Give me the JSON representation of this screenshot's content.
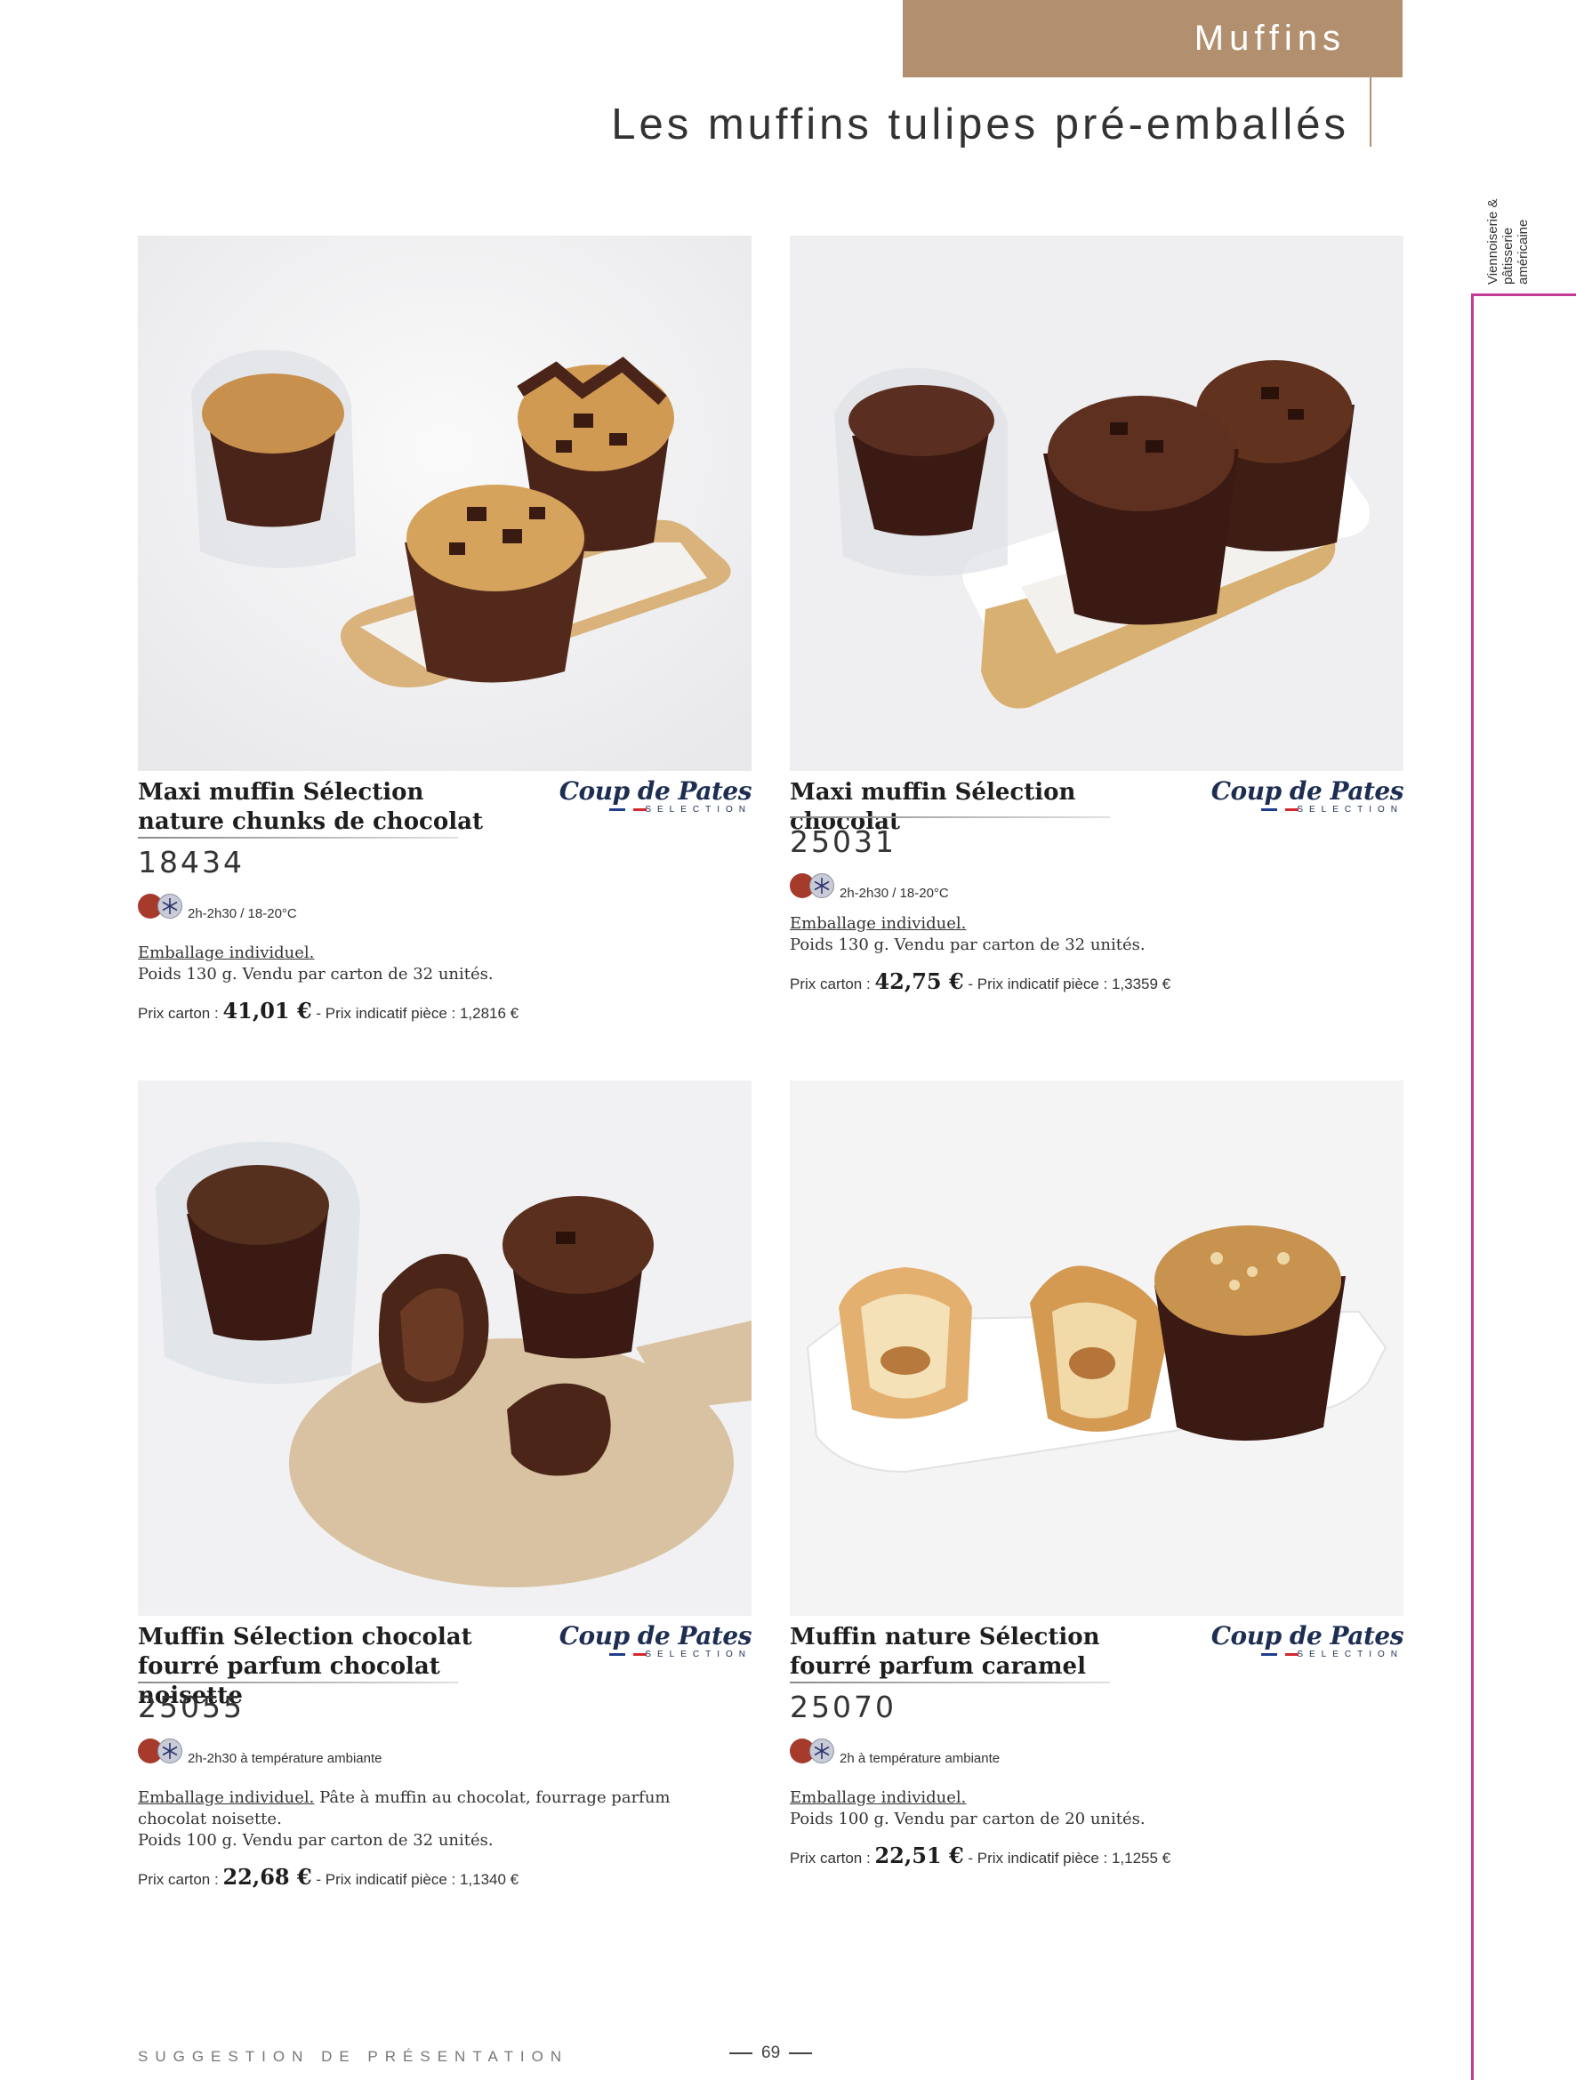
{
  "header": {
    "section": "Muffins",
    "title": "Les muffins tulipes pré-emballés",
    "side_label": "Viennoiserie & pâtisserie américaine"
  },
  "brand": {
    "name": "Coup de Pates",
    "sub": "SELECTION"
  },
  "colors": {
    "accent": "#b2906f",
    "side_rule": "#c43b96",
    "frozen_dot": "#a63a2b"
  },
  "products": [
    {
      "name": "Maxi muffin Sélection nature chunks de chocolat",
      "code": "18434",
      "storage_icons": [
        "frozen-dot-icon",
        "snowflake-icon"
      ],
      "thaw": "2h-2h30 / 18-20°C",
      "packaging": "Emballage individuel.",
      "extra": "",
      "details": "Poids 130 g. Vendu par carton de 32 unités.",
      "price_label": "Prix carton :",
      "price": "41,01 €",
      "unit_price": "- Prix indicatif pièce : 1,2816 €"
    },
    {
      "name": "Maxi muffin Sélection chocolat",
      "code": "25031",
      "storage_icons": [
        "frozen-dot-icon",
        "snowflake-icon"
      ],
      "thaw": "2h-2h30 / 18-20°C",
      "packaging": "Emballage individuel.",
      "extra": "",
      "details": "Poids 130 g. Vendu par carton de 32 unités.",
      "price_label": "Prix carton :",
      "price": "42,75 €",
      "unit_price": "- Prix indicatif pièce : 1,3359 €"
    },
    {
      "name": "Muffin Sélection chocolat fourré parfum chocolat noisette",
      "code": "25055",
      "storage_icons": [
        "frozen-dot-icon",
        "snowflake-icon"
      ],
      "thaw": "2h-2h30 à température ambiante",
      "packaging": "Emballage individuel.",
      "extra": " Pâte à muffin au chocolat, fourrage parfum chocolat noisette.",
      "details": "Poids 100 g. Vendu par carton de 32 unités.",
      "price_label": "Prix carton :",
      "price": "22,68 €",
      "unit_price": "- Prix indicatif pièce : 1,1340 €"
    },
    {
      "name": "Muffin nature Sélection fourré parfum caramel",
      "code": "25070",
      "storage_icons": [
        "frozen-dot-icon",
        "snowflake-icon"
      ],
      "thaw": "2h à température ambiante",
      "packaging": "Emballage individuel.",
      "extra": "",
      "details": "Poids 100 g. Vendu par carton de 20 unités.",
      "price_label": "Prix carton :",
      "price": "22,51 €",
      "unit_price": "- Prix indicatif pièce : 1,1255 €"
    }
  ],
  "footer": {
    "note": "SUGGESTION DE PRÉSENTATION",
    "page": "69"
  }
}
